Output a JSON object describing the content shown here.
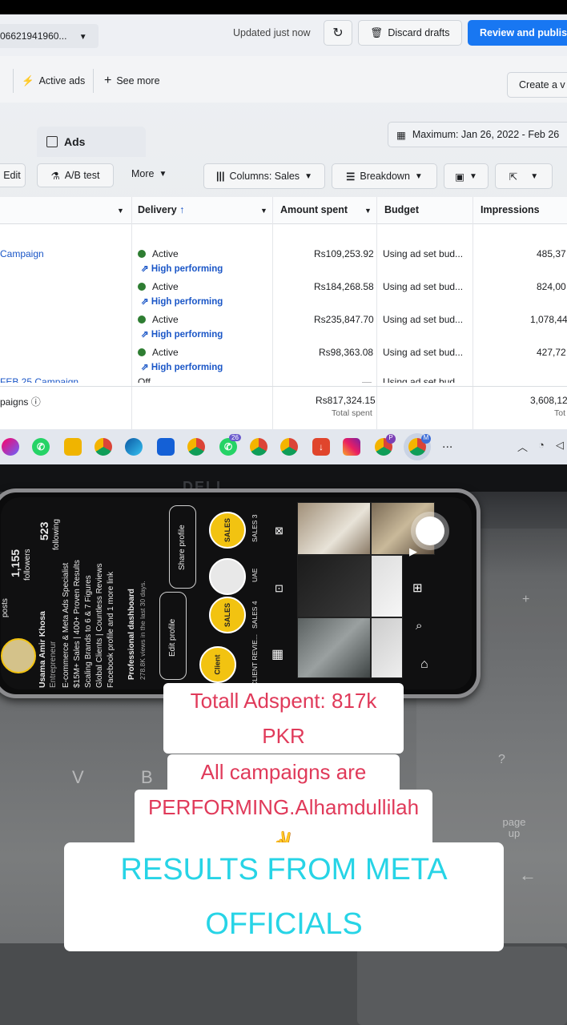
{
  "ads_manager": {
    "account_id": "06621941960...",
    "updated_text": "Updated just now",
    "discard_label": "Discard drafts",
    "review_label": "Review and publish",
    "filters": {
      "active_ads": "Active ads",
      "see_more": "See more",
      "create": "Create a v"
    },
    "tab_ads": "Ads",
    "date_range": "Maximum: Jan 26, 2022 - Feb 26",
    "toolbar": {
      "edit": "Edit",
      "ab_test": "A/B test",
      "more": "More",
      "columns": "Columns: Sales",
      "breakdown": "Breakdown"
    },
    "columns": [
      "Delivery",
      "Amount spent",
      "Budget",
      "Impressions"
    ],
    "rows": [
      {
        "name": "Campaign",
        "status": "Active",
        "tag": "High performing",
        "spent": "Rs109,253.92",
        "budget": "Using ad set bud...",
        "impressions": "485,37"
      },
      {
        "name": "",
        "status": "Active",
        "tag": "High performing",
        "spent": "Rs184,268.58",
        "budget": "Using ad set bud...",
        "impressions": "824,00"
      },
      {
        "name": "",
        "status": "Active",
        "tag": "High performing",
        "spent": "Rs235,847.70",
        "budget": "Using ad set bud...",
        "impressions": "1,078,44"
      },
      {
        "name": "",
        "status": "Active",
        "tag": "High performing",
        "spent": "Rs98,363.08",
        "budget": "Using ad set bud...",
        "impressions": "427,72"
      },
      {
        "name": "FEB 25 Campaign",
        "status": "Off",
        "tag": "",
        "spent": "—",
        "budget": "Using ad set bud",
        "impressions": ""
      }
    ],
    "totals": {
      "label": "paigns",
      "spent": "Rs817,324.15",
      "spent_sub": "Total spent",
      "impressions": "3,608,12",
      "impressions_sub": "Tot"
    }
  },
  "taskbar": {
    "badge_1": "26",
    "badge_2": "P",
    "badge_3": "M",
    "more": "..."
  },
  "laptop_logo": "DELL",
  "keys": {
    "v": "V",
    "b": "B",
    "page_up": "page up"
  },
  "phone_profile": {
    "posts_label": "posts",
    "followers": "1,155",
    "followers_label": "followers",
    "following": "523",
    "following_label": "following",
    "name": "Usama Amir Khosa",
    "role": "Entrepreneur",
    "bio": [
      "E-commerce & Meta Ads Specialist",
      "$15M+ Sales | 400+ Proven Results",
      "Scaling Brands to 6 & 7 Figures",
      "Global Clients | Countless Reviews",
      "Facebook profile and 1 more link"
    ],
    "dashboard": "Professional dashboard",
    "dashboard_sub": "278.8K views in the last 30 days.",
    "edit_profile": "Edit profile",
    "share_profile": "Share profile",
    "highlights": [
      {
        "badge": "SALES",
        "label": "SALES 3"
      },
      {
        "badge": "",
        "label": "UAE"
      },
      {
        "badge": "SALES",
        "label": "SALES 4"
      },
      {
        "badge": "Client",
        "label": "CLIENT REVIE..."
      }
    ]
  },
  "captions": {
    "adspent": "Totall Adspent: 817k PKR",
    "high_line1": "All campaigns are HIGH",
    "high_line2": "PERFORMING.Alhamdullilah ✌",
    "results": "RESULTS FROM META OFFICIALS"
  }
}
